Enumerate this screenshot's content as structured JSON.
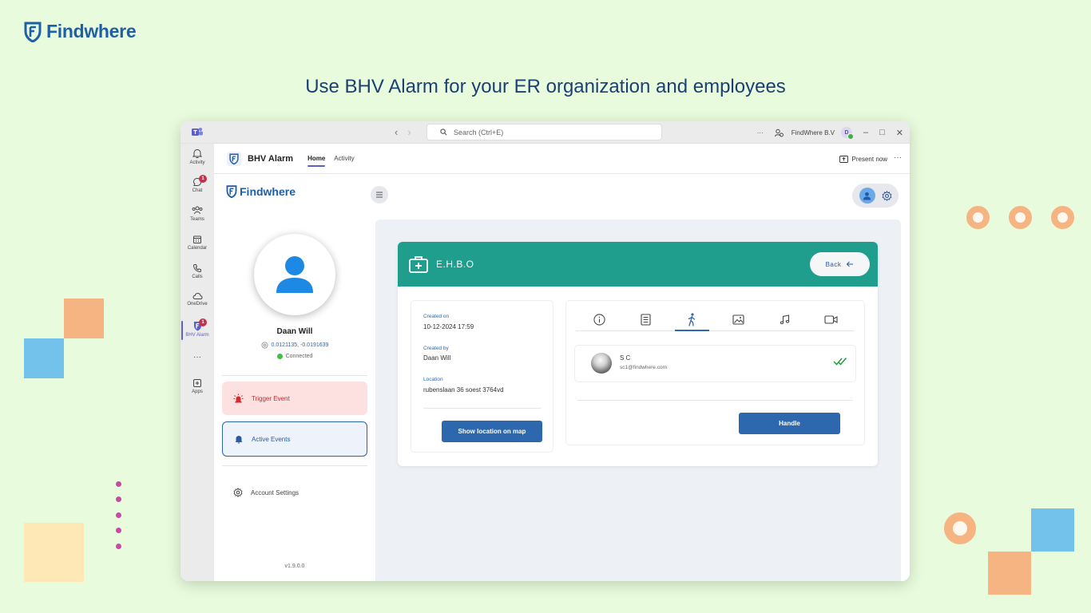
{
  "brand": {
    "name": "Findwhere",
    "color": "#1f5fa8"
  },
  "headline": "Use BHV Alarm for your ER organization and employees",
  "titlebar": {
    "search_placeholder": "Search (Ctrl+E)",
    "org_name": "FindWhere B.V",
    "user_initial": "D",
    "more": "···"
  },
  "rail": {
    "items": [
      {
        "label": "Activity",
        "icon": "bell-icon"
      },
      {
        "label": "Chat",
        "icon": "chat-icon",
        "badge": "1"
      },
      {
        "label": "Teams",
        "icon": "teams-icon"
      },
      {
        "label": "Calendar",
        "icon": "calendar-icon"
      },
      {
        "label": "Calls",
        "icon": "phone-icon"
      },
      {
        "label": "OneDrive",
        "icon": "cloud-icon"
      },
      {
        "label": "BHV Alarm",
        "icon": "findwhere-shield-icon",
        "badge": "1"
      },
      {
        "label": "···"
      },
      {
        "label": "Apps",
        "icon": "plus-square-icon"
      }
    ]
  },
  "app_header": {
    "title": "BHV Alarm",
    "tabs": [
      {
        "label": "Home"
      },
      {
        "label": "Activity"
      }
    ],
    "present_label": "Present now",
    "more": "···"
  },
  "left_panel": {
    "brand": "Findwhere",
    "user_name": "Daan Will",
    "coordinates": "0.0121135, -0.0191639",
    "status": "Connected",
    "trigger_label": "Trigger Event",
    "active_label": "Active Events",
    "settings_label": "Account Settings",
    "version": "v1.9.0.0"
  },
  "event_card": {
    "title": "E.H.B.O",
    "back_label": "Back",
    "header_color": "#1f9e8e",
    "created_on_label": "Created on",
    "created_on_value": "10-12-2024 17:59",
    "created_by_label": "Created by",
    "created_by_value": "Daan Will",
    "location_label": "Location",
    "location_value": "rubenslaan 36 soest 3764vd",
    "map_button": "Show location on map",
    "tabs": [
      "info-icon",
      "list-icon",
      "walking-person-icon",
      "image-icon",
      "music-note-icon",
      "video-camera-icon"
    ],
    "active_tab": "walking-person-icon",
    "responder": {
      "name": "S C",
      "email": "sc1@findwhere.com"
    },
    "handle_button": "Handle"
  }
}
